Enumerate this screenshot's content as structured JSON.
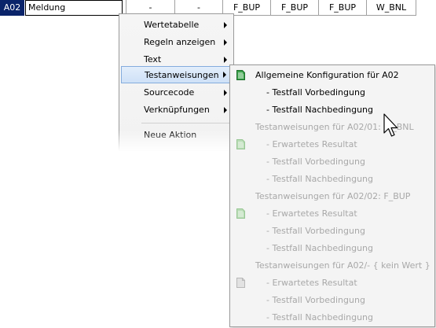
{
  "grid": {
    "id": "A02",
    "name": "Meldung",
    "cells": [
      "-",
      "-",
      "F_BUP",
      "F_BUP",
      "F_BUP",
      "W_BNL"
    ]
  },
  "context_menu": {
    "items": [
      {
        "label": "Wertetabelle",
        "has_submenu": true
      },
      {
        "label": "Regeln anzeigen",
        "has_submenu": true
      },
      {
        "label": "Text",
        "has_submenu": true
      },
      {
        "label": "Testanweisungen",
        "has_submenu": true,
        "selected": true
      },
      {
        "label": "Sourcecode",
        "has_submenu": true
      },
      {
        "label": "Verknüpfungen",
        "has_submenu": true
      },
      {
        "label": "Neue Aktion",
        "has_submenu": false
      }
    ]
  },
  "submenu": {
    "items": [
      {
        "label": "Allgemeine Konfiguration für A02",
        "enabled": true,
        "icon": "green-document-icon"
      },
      {
        "label": "- Testfall Vorbedingung",
        "enabled": true
      },
      {
        "label": "- Testfall Nachbedingung",
        "enabled": true
      },
      {
        "label": "Testanweisungen für A02/01: W_BNL",
        "enabled": false
      },
      {
        "label": "- Erwartetes Resultat",
        "enabled": false,
        "icon": "faded-green-document-icon"
      },
      {
        "label": "- Testfall Vorbedingung",
        "enabled": false
      },
      {
        "label": "- Testfall Nachbedingung",
        "enabled": false
      },
      {
        "label": "Testanweisungen für A02/02:  F_BUP",
        "enabled": false
      },
      {
        "label": "- Erwartetes Resultat",
        "enabled": false,
        "icon": "faded-green-document-icon"
      },
      {
        "label": "- Testfall Vorbedingung",
        "enabled": false
      },
      {
        "label": "- Testfall Nachbedingung",
        "enabled": false
      },
      {
        "label": "Testanweisungen für A02/- { kein Wert }",
        "enabled": false
      },
      {
        "label": "- Erwartetes Resultat",
        "enabled": false,
        "icon": "gray-document-icon"
      },
      {
        "label": "- Testfall Vorbedingung",
        "enabled": false
      },
      {
        "label": "- Testfall Nachbedingung",
        "enabled": false
      }
    ]
  },
  "colors": {
    "selection_bg": "#cfe1f7",
    "selection_border": "#84acdd",
    "id_cell_bg": "#0a246a",
    "disabled_text": "#a8a8a8"
  }
}
